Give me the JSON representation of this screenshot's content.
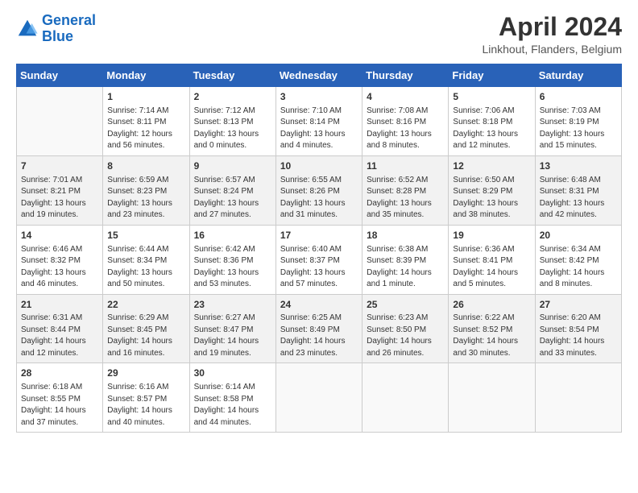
{
  "logo": {
    "line1": "General",
    "line2": "Blue"
  },
  "title": "April 2024",
  "location": "Linkhout, Flanders, Belgium",
  "weekdays": [
    "Sunday",
    "Monday",
    "Tuesday",
    "Wednesday",
    "Thursday",
    "Friday",
    "Saturday"
  ],
  "rows": [
    [
      {
        "day": "",
        "info": ""
      },
      {
        "day": "1",
        "info": "Sunrise: 7:14 AM\nSunset: 8:11 PM\nDaylight: 12 hours\nand 56 minutes."
      },
      {
        "day": "2",
        "info": "Sunrise: 7:12 AM\nSunset: 8:13 PM\nDaylight: 13 hours\nand 0 minutes."
      },
      {
        "day": "3",
        "info": "Sunrise: 7:10 AM\nSunset: 8:14 PM\nDaylight: 13 hours\nand 4 minutes."
      },
      {
        "day": "4",
        "info": "Sunrise: 7:08 AM\nSunset: 8:16 PM\nDaylight: 13 hours\nand 8 minutes."
      },
      {
        "day": "5",
        "info": "Sunrise: 7:06 AM\nSunset: 8:18 PM\nDaylight: 13 hours\nand 12 minutes."
      },
      {
        "day": "6",
        "info": "Sunrise: 7:03 AM\nSunset: 8:19 PM\nDaylight: 13 hours\nand 15 minutes."
      }
    ],
    [
      {
        "day": "7",
        "info": "Sunrise: 7:01 AM\nSunset: 8:21 PM\nDaylight: 13 hours\nand 19 minutes."
      },
      {
        "day": "8",
        "info": "Sunrise: 6:59 AM\nSunset: 8:23 PM\nDaylight: 13 hours\nand 23 minutes."
      },
      {
        "day": "9",
        "info": "Sunrise: 6:57 AM\nSunset: 8:24 PM\nDaylight: 13 hours\nand 27 minutes."
      },
      {
        "day": "10",
        "info": "Sunrise: 6:55 AM\nSunset: 8:26 PM\nDaylight: 13 hours\nand 31 minutes."
      },
      {
        "day": "11",
        "info": "Sunrise: 6:52 AM\nSunset: 8:28 PM\nDaylight: 13 hours\nand 35 minutes."
      },
      {
        "day": "12",
        "info": "Sunrise: 6:50 AM\nSunset: 8:29 PM\nDaylight: 13 hours\nand 38 minutes."
      },
      {
        "day": "13",
        "info": "Sunrise: 6:48 AM\nSunset: 8:31 PM\nDaylight: 13 hours\nand 42 minutes."
      }
    ],
    [
      {
        "day": "14",
        "info": "Sunrise: 6:46 AM\nSunset: 8:32 PM\nDaylight: 13 hours\nand 46 minutes."
      },
      {
        "day": "15",
        "info": "Sunrise: 6:44 AM\nSunset: 8:34 PM\nDaylight: 13 hours\nand 50 minutes."
      },
      {
        "day": "16",
        "info": "Sunrise: 6:42 AM\nSunset: 8:36 PM\nDaylight: 13 hours\nand 53 minutes."
      },
      {
        "day": "17",
        "info": "Sunrise: 6:40 AM\nSunset: 8:37 PM\nDaylight: 13 hours\nand 57 minutes."
      },
      {
        "day": "18",
        "info": "Sunrise: 6:38 AM\nSunset: 8:39 PM\nDaylight: 14 hours\nand 1 minute."
      },
      {
        "day": "19",
        "info": "Sunrise: 6:36 AM\nSunset: 8:41 PM\nDaylight: 14 hours\nand 5 minutes."
      },
      {
        "day": "20",
        "info": "Sunrise: 6:34 AM\nSunset: 8:42 PM\nDaylight: 14 hours\nand 8 minutes."
      }
    ],
    [
      {
        "day": "21",
        "info": "Sunrise: 6:31 AM\nSunset: 8:44 PM\nDaylight: 14 hours\nand 12 minutes."
      },
      {
        "day": "22",
        "info": "Sunrise: 6:29 AM\nSunset: 8:45 PM\nDaylight: 14 hours\nand 16 minutes."
      },
      {
        "day": "23",
        "info": "Sunrise: 6:27 AM\nSunset: 8:47 PM\nDaylight: 14 hours\nand 19 minutes."
      },
      {
        "day": "24",
        "info": "Sunrise: 6:25 AM\nSunset: 8:49 PM\nDaylight: 14 hours\nand 23 minutes."
      },
      {
        "day": "25",
        "info": "Sunrise: 6:23 AM\nSunset: 8:50 PM\nDaylight: 14 hours\nand 26 minutes."
      },
      {
        "day": "26",
        "info": "Sunrise: 6:22 AM\nSunset: 8:52 PM\nDaylight: 14 hours\nand 30 minutes."
      },
      {
        "day": "27",
        "info": "Sunrise: 6:20 AM\nSunset: 8:54 PM\nDaylight: 14 hours\nand 33 minutes."
      }
    ],
    [
      {
        "day": "28",
        "info": "Sunrise: 6:18 AM\nSunset: 8:55 PM\nDaylight: 14 hours\nand 37 minutes."
      },
      {
        "day": "29",
        "info": "Sunrise: 6:16 AM\nSunset: 8:57 PM\nDaylight: 14 hours\nand 40 minutes."
      },
      {
        "day": "30",
        "info": "Sunrise: 6:14 AM\nSunset: 8:58 PM\nDaylight: 14 hours\nand 44 minutes."
      },
      {
        "day": "",
        "info": ""
      },
      {
        "day": "",
        "info": ""
      },
      {
        "day": "",
        "info": ""
      },
      {
        "day": "",
        "info": ""
      }
    ]
  ]
}
